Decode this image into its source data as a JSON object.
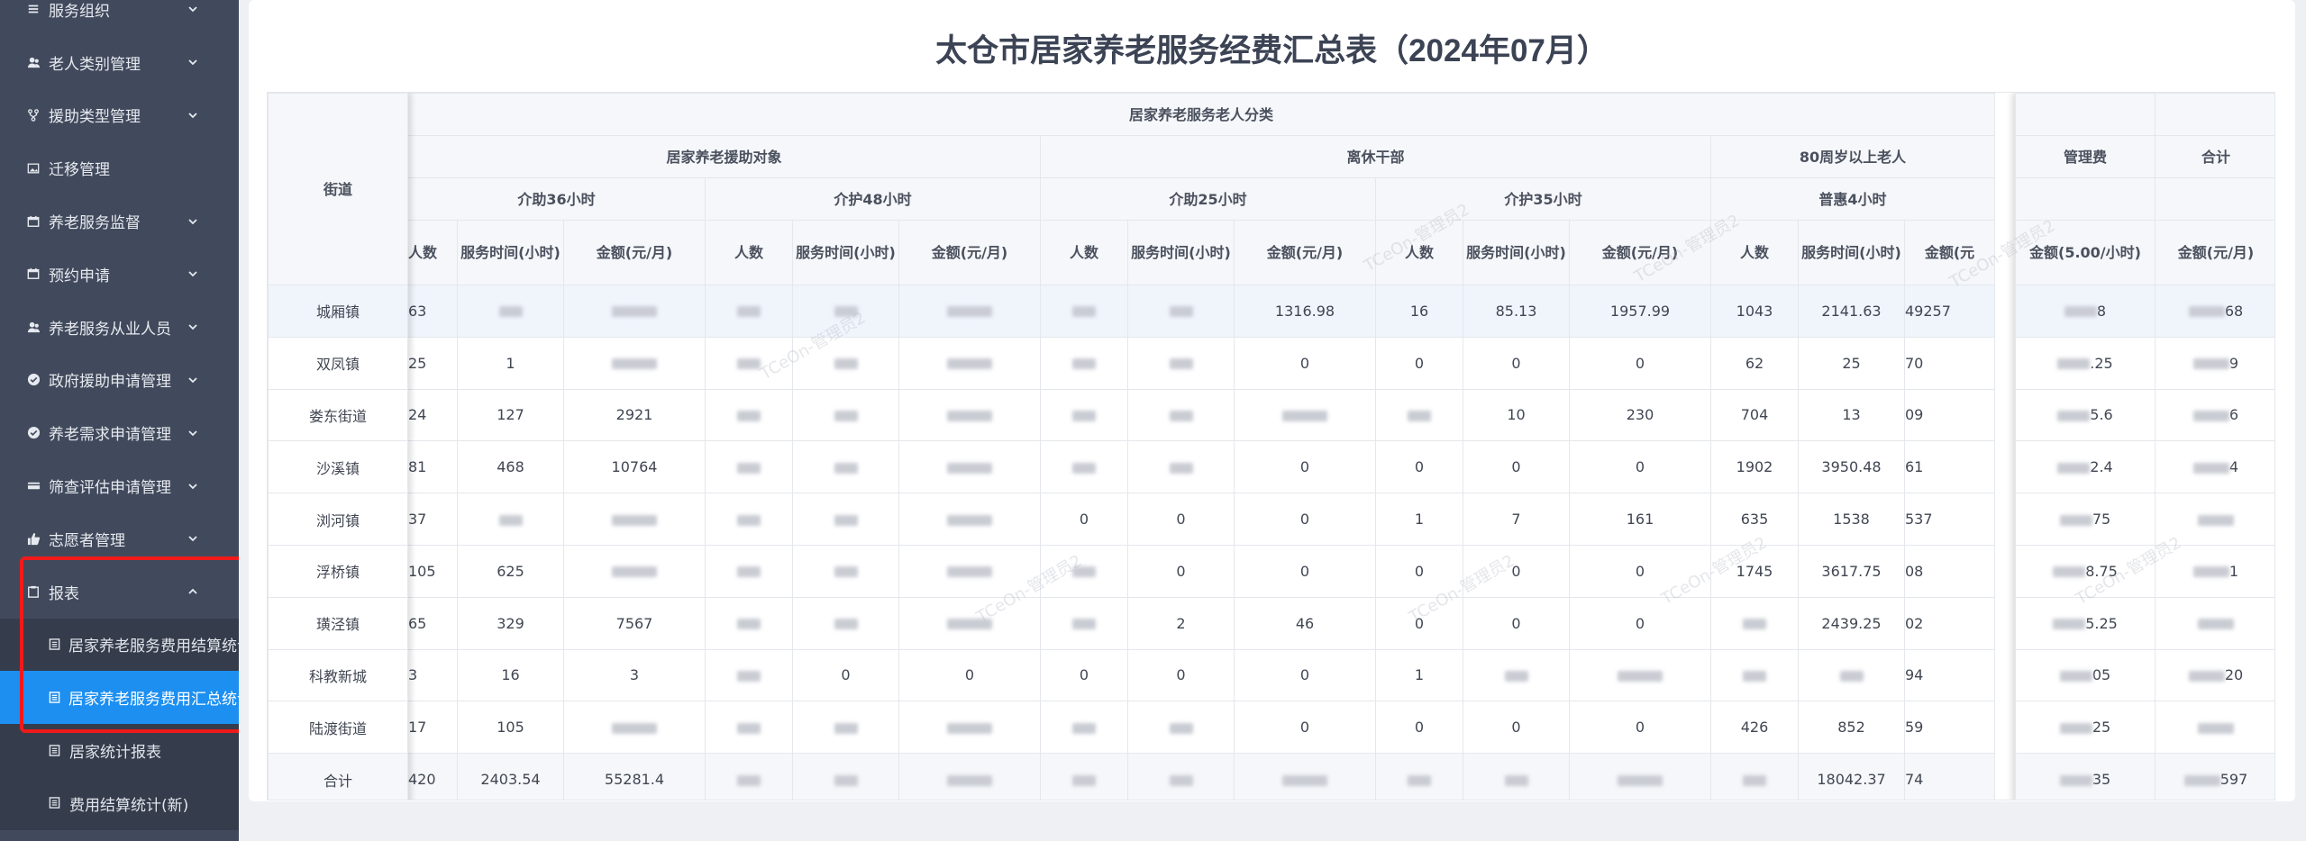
{
  "sidebar": {
    "items": [
      {
        "label": "服务组织",
        "icon": "list-icon",
        "expanded": false
      },
      {
        "label": "老人类别管理",
        "icon": "users-icon",
        "expanded": false
      },
      {
        "label": "援助类型管理",
        "icon": "fork-icon",
        "expanded": false
      },
      {
        "label": "迁移管理",
        "icon": "image-icon",
        "expanded": false
      },
      {
        "label": "养老服务监督",
        "icon": "calendar-icon",
        "expanded": false
      },
      {
        "label": "预约申请",
        "icon": "calendar-icon",
        "expanded": false
      },
      {
        "label": "养老服务从业人员",
        "icon": "users-icon",
        "expanded": false
      },
      {
        "label": "政府援助申请管理",
        "icon": "check-circle-icon",
        "expanded": false
      },
      {
        "label": "养老需求申请管理",
        "icon": "check-circle-icon",
        "expanded": false
      },
      {
        "label": "筛查评估申请管理",
        "icon": "card-icon",
        "expanded": false
      },
      {
        "label": "志愿者管理",
        "icon": "thumbs-up-icon",
        "expanded": false
      },
      {
        "label": "报表",
        "icon": "clipboard-icon",
        "expanded": true
      }
    ],
    "report_subitems": [
      {
        "label": "居家养老服务费用结算统计",
        "active": false
      },
      {
        "label": "居家养老服务费用汇总统计",
        "active": true
      },
      {
        "label": "居家统计报表",
        "active": false
      },
      {
        "label": "费用结算统计(新)",
        "active": false
      }
    ]
  },
  "report": {
    "title": "太仓市居家养老服务经费汇总表（2024年07月）",
    "header": {
      "street": "街道",
      "top_group": "居家养老服务老人分类",
      "groups": [
        "居家养老援助对象",
        "离休干部",
        "80周岁以上老人"
      ],
      "subgroups": [
        "介助36小时",
        "介护48小时",
        "介助25小时",
        "介护35小时",
        "普惠4小时"
      ],
      "col_people": "人数",
      "col_hours": "服务时间(小时)",
      "col_amount": "金额(元/月)",
      "col_amount_cut": "金额(元",
      "management_fee": "管理费",
      "management_amount": "金额(5.00/小时)",
      "total": "合计",
      "total_amount": "金额(元/月)"
    },
    "rows": [
      {
        "street": "城厢镇",
        "cells": [
          "63",
          "",
          "",
          "",
          "",
          "",
          "",
          "",
          "1316.98",
          "16",
          "85.13",
          "1957.99",
          "1043",
          "2141.63",
          "49257"
        ],
        "mgmt": "8",
        "total": "68"
      },
      {
        "street": "双凤镇",
        "cells": [
          "25",
          "1",
          "",
          "",
          "",
          "",
          "",
          "",
          "0",
          "0",
          "0",
          "0",
          "62",
          "25",
          "70"
        ],
        "mgmt": ".25",
        "total": "9"
      },
      {
        "street": "娄东街道",
        "cells": [
          "24",
          "127",
          "2921",
          "",
          "",
          "",
          "",
          "",
          "",
          "",
          "10",
          "230",
          "704",
          "13",
          "09"
        ],
        "mgmt": "5.6",
        "total": "6"
      },
      {
        "street": "沙溪镇",
        "cells": [
          "81",
          "468",
          "10764",
          "",
          "",
          "",
          "",
          "",
          "0",
          "0",
          "0",
          "0",
          "1902",
          "3950.48",
          "61"
        ],
        "mgmt": "2.4",
        "total": "4"
      },
      {
        "street": "浏河镇",
        "cells": [
          "37",
          "",
          "",
          "",
          "",
          "",
          "0",
          "0",
          "0",
          "1",
          "7",
          "161",
          "635",
          "1538",
          "537"
        ],
        "mgmt": "75",
        "total": ""
      },
      {
        "street": "浮桥镇",
        "cells": [
          "105",
          "625",
          "",
          "",
          "",
          "",
          "",
          "0",
          "0",
          "0",
          "0",
          "0",
          "1745",
          "3617.75",
          "08"
        ],
        "mgmt": "8.75",
        "total": "1"
      },
      {
        "street": "璜泾镇",
        "cells": [
          "65",
          "329",
          "7567",
          "",
          "",
          "",
          "",
          "2",
          "46",
          "0",
          "0",
          "0",
          "",
          "2439.25",
          "02"
        ],
        "mgmt": "5.25",
        "total": ""
      },
      {
        "street": "科教新城",
        "cells": [
          "3",
          "16",
          "3",
          "",
          "0",
          "0",
          "0",
          "0",
          "0",
          "1",
          "",
          "",
          "",
          "",
          "94"
        ],
        "mgmt": "05",
        "total": "20"
      },
      {
        "street": "陆渡街道",
        "cells": [
          "17",
          "105",
          "",
          "",
          "",
          "",
          "",
          "",
          "0",
          "0",
          "0",
          "0",
          "426",
          "852",
          "59"
        ],
        "mgmt": "25",
        "total": ""
      },
      {
        "street": "合计",
        "cells": [
          "420",
          "2403.54",
          "55281.4",
          "",
          "",
          "",
          "",
          "",
          "",
          "",
          "",
          "",
          "",
          "18042.37",
          "74"
        ],
        "mgmt": "35",
        "total": "597"
      }
    ]
  },
  "watermark": "TCeOn-管理员2",
  "colors": {
    "sidebar_bg": "#414a5c",
    "active_item": "#1c8ff1",
    "highlight_border": "#f01a1a",
    "title_color": "#3b4354"
  }
}
